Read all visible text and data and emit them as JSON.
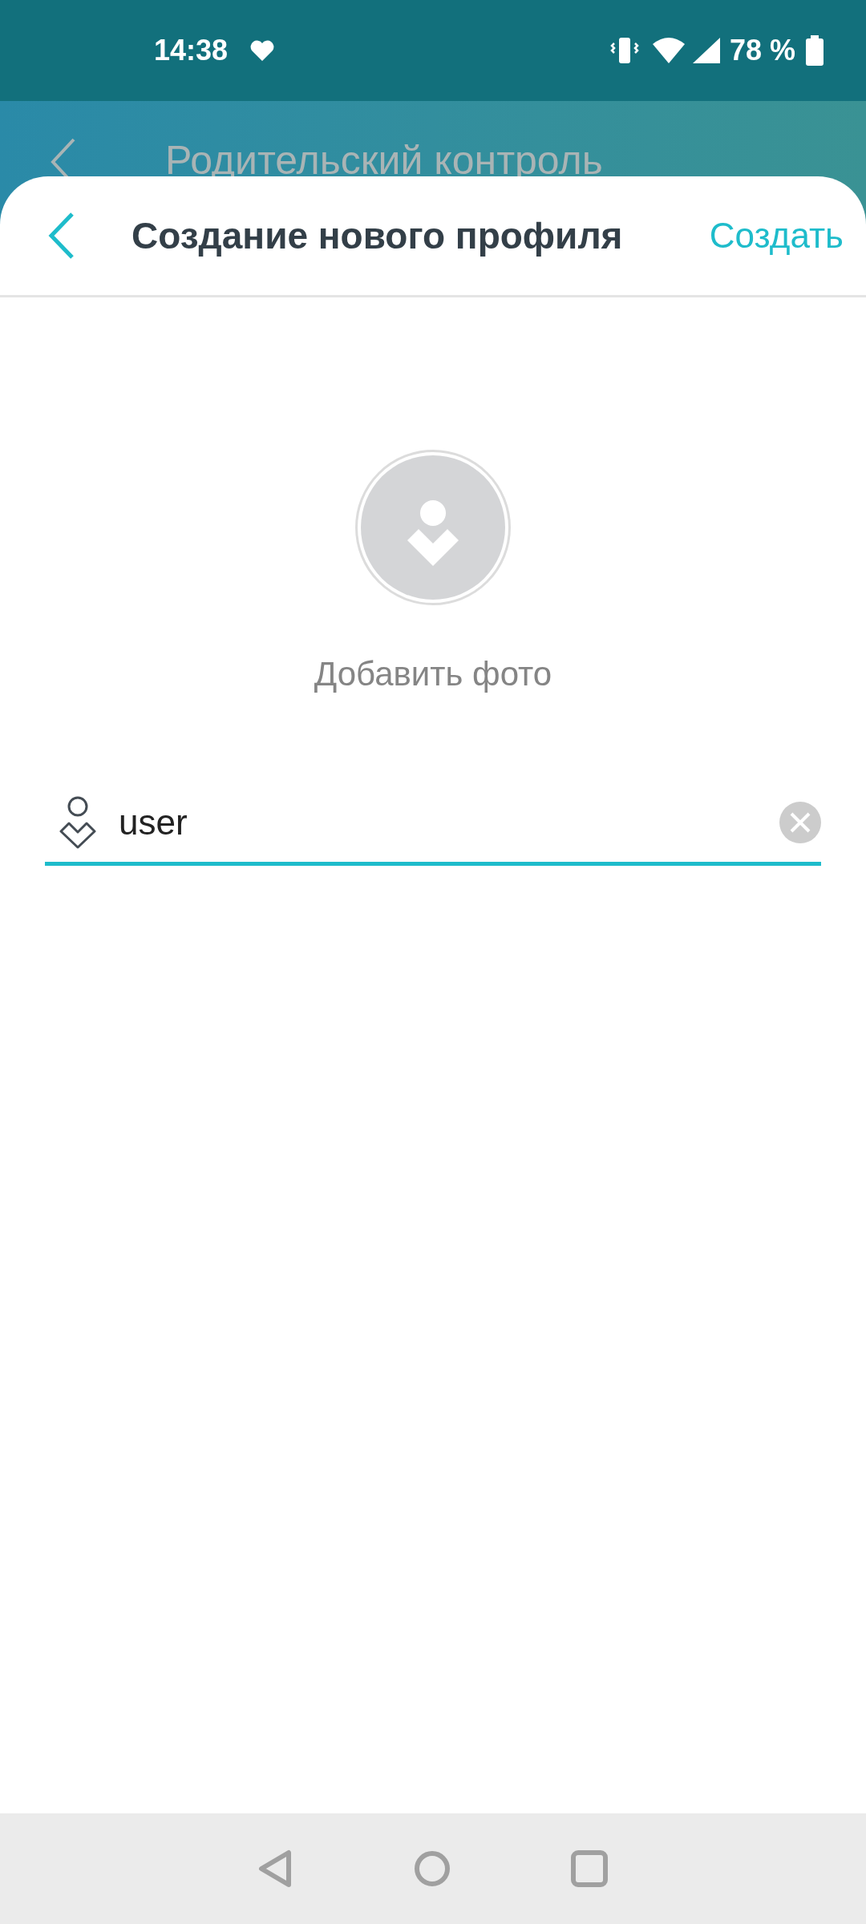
{
  "status_bar": {
    "time": "14:38",
    "battery": "78 %"
  },
  "background_screen": {
    "title": "Родительский контроль"
  },
  "sheet": {
    "title": "Создание нового профиля",
    "action": "Создать"
  },
  "photo": {
    "label": "Добавить фото"
  },
  "name_field": {
    "value": "user"
  }
}
